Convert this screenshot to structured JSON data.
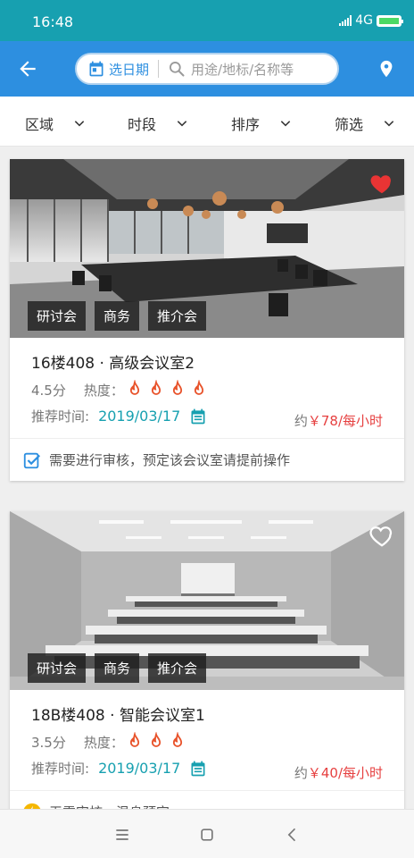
{
  "status_bar": {
    "time": "16:48",
    "network": "4G"
  },
  "app_bar": {
    "back_icon": "arrow-left-icon",
    "date_button_label": "选日期",
    "search_placeholder": "用途/地标/名称等",
    "location_icon": "map-pin-icon"
  },
  "filters": [
    {
      "label": "区域"
    },
    {
      "label": "时段"
    },
    {
      "label": "排序"
    },
    {
      "label": "筛选"
    }
  ],
  "rooms": [
    {
      "title": "16楼408 · 高级会议室2",
      "tags": [
        "研讨会",
        "商务",
        "推介会"
      ],
      "favorited": true,
      "rating": "4.5分",
      "heat_label": "热度：",
      "heat_level": 4,
      "date_label": "推荐时间:",
      "date": "2019/03/17",
      "price_prefix": "约",
      "price": "￥78",
      "price_unit": "/每小时",
      "notice": "需要进行审核，预定该会议室请提前操作"
    },
    {
      "title": "18B楼408 · 智能会议室1",
      "tags": [
        "研讨会",
        "商务",
        "推介会"
      ],
      "favorited": false,
      "rating": "3.5分",
      "heat_label": "热度：",
      "heat_level": 3,
      "date_label": "推荐时间:",
      "date": "2019/03/17",
      "price_prefix": "约",
      "price": "￥40",
      "price_unit": "/每小时",
      "notice": "无需审核，温息预定"
    }
  ],
  "colors": {
    "accent": "#2d8fe0",
    "status_bar": "#17a0b0",
    "price": "#e64040",
    "flame": "#e8532b"
  }
}
